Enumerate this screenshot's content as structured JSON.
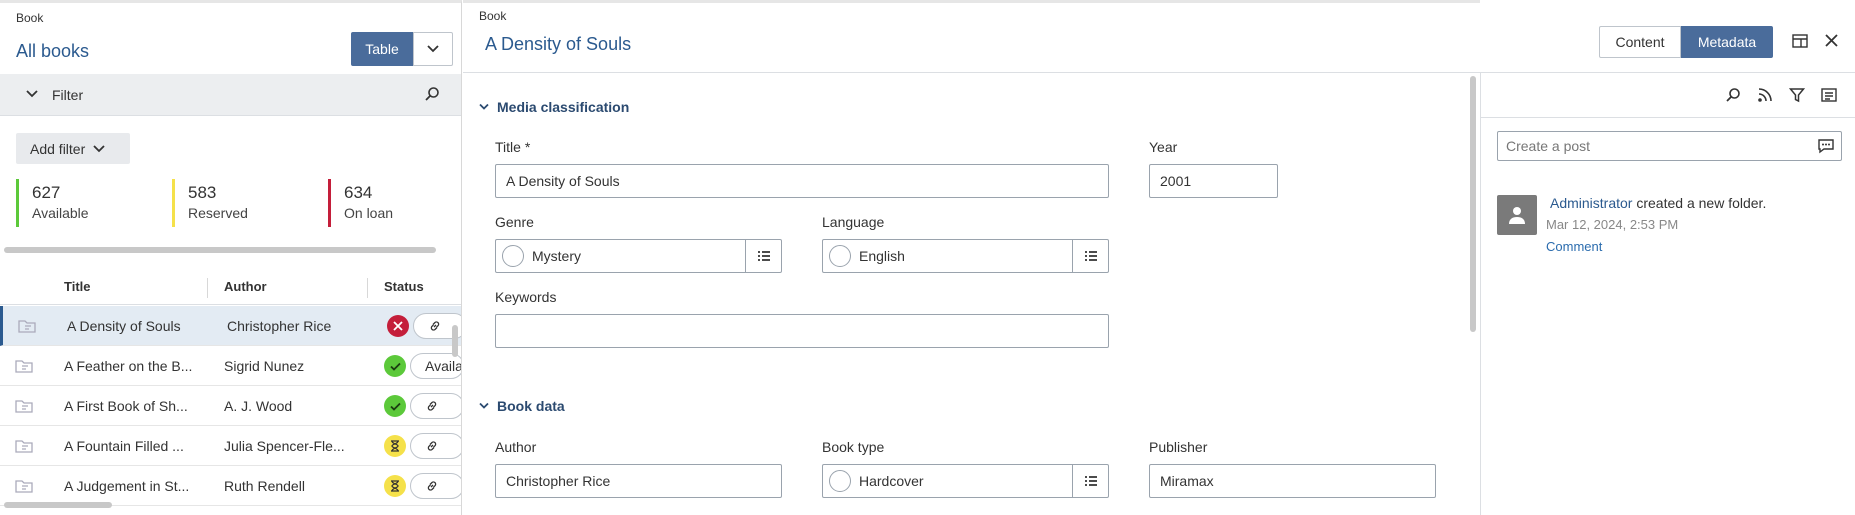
{
  "left": {
    "breadcrumb": "Book",
    "title": "All books",
    "view_button": "Table",
    "filter_label": "Filter",
    "add_filter": "Add filter",
    "stats": [
      {
        "count": "627",
        "label": "Available",
        "color": "#5cc93a"
      },
      {
        "count": "583",
        "label": "Reserved",
        "color": "#f5e14a"
      },
      {
        "count": "634",
        "label": "On loan",
        "color": "#c41e3a"
      }
    ],
    "columns": [
      "Title",
      "Author",
      "Status"
    ],
    "rows": [
      {
        "title": "A Density of Souls",
        "author": "Christopher Rice",
        "status": "on-loan",
        "action": ""
      },
      {
        "title": "A Feather on the B...",
        "author": "Sigrid Nunez",
        "status": "available",
        "action": "Availa"
      },
      {
        "title": "A First Book of Sh...",
        "author": "A. J. Wood",
        "status": "available",
        "action": ""
      },
      {
        "title": "A Fountain Filled ...",
        "author": "Julia Spencer-Fle...",
        "status": "reserved",
        "action": ""
      },
      {
        "title": "A Judgement in St...",
        "author": "Ruth Rendell",
        "status": "reserved",
        "action": ""
      }
    ]
  },
  "detail": {
    "breadcrumb": "Book",
    "title": "A Density of Souls",
    "tab_content": "Content",
    "tab_metadata": "Metadata",
    "sections": {
      "media": "Media classification",
      "book": "Book data"
    },
    "fields": {
      "title_label": "Title *",
      "title_value": "A Density of Souls",
      "year_label": "Year",
      "year_value": "2001",
      "genre_label": "Genre",
      "genre_value": "Mystery",
      "language_label": "Language",
      "language_value": "English",
      "keywords_label": "Keywords",
      "keywords_value": "",
      "author_label": "Author",
      "author_value": "Christopher Rice",
      "booktype_label": "Book type",
      "booktype_value": "Hardcover",
      "publisher_label": "Publisher",
      "publisher_value": "Miramax"
    }
  },
  "feed": {
    "post_placeholder": "Create a post",
    "activity_user": "Administrator",
    "activity_text": " created a new folder.",
    "timestamp": "Mar 12, 2024, 2:53 PM",
    "comment": "Comment"
  }
}
